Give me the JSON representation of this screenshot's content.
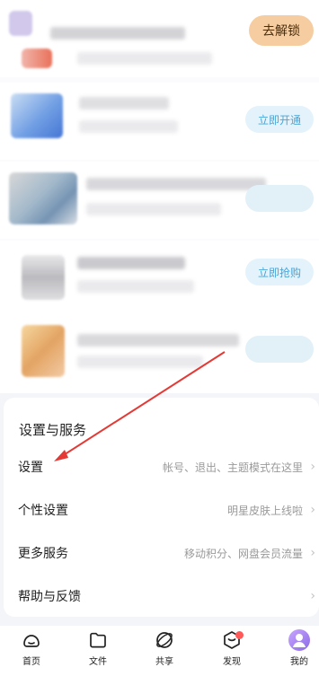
{
  "promo": {
    "unlock_button": "去解锁",
    "activate_button": "立即开通",
    "grab_button": "立即抢购"
  },
  "settings": {
    "section_title": "设置与服务",
    "rows": [
      {
        "label": "设置",
        "desc": "帐号、退出、主题模式在这里"
      },
      {
        "label": "个性设置",
        "desc": "明星皮肤上线啦"
      },
      {
        "label": "更多服务",
        "desc": "移动积分、网盘会员流量"
      },
      {
        "label": "帮助与反馈",
        "desc": ""
      }
    ]
  },
  "tabbar": {
    "items": [
      {
        "label": "首页",
        "icon": "home-icon"
      },
      {
        "label": "文件",
        "icon": "folder-icon"
      },
      {
        "label": "共享",
        "icon": "share-icon"
      },
      {
        "label": "发现",
        "icon": "discover-icon"
      },
      {
        "label": "我的",
        "icon": "profile-avatar-icon"
      }
    ]
  },
  "colors": {
    "unlock_bg": "#f5cda0",
    "blue_button_text": "#4aa5d6",
    "annotation_arrow": "#e53935",
    "badge": "#ff5a5a"
  }
}
